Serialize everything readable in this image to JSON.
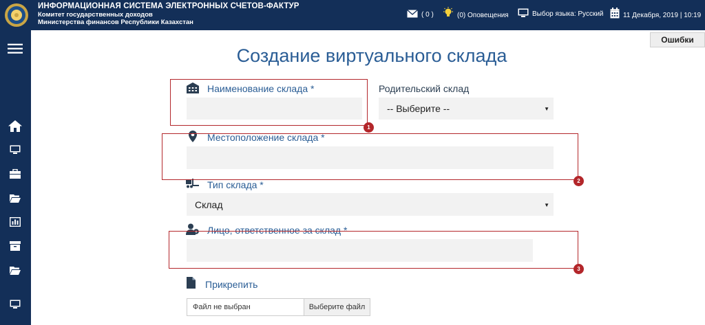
{
  "header": {
    "title": "ИНФОРМАЦИОННАЯ СИСТЕМА ЭЛЕКТРОННЫХ СЧЕТОВ-ФАКТУР",
    "subtitle1": "Комитет государственных доходов",
    "subtitle2": "Министерства финансов Республики Казахстан",
    "messages": "( 0 )",
    "notifications": "(0) Оповещения",
    "language": "Выбор языка: Русский",
    "datetime": "11 Декабря, 2019 | 10:19"
  },
  "errors_button": "Ошибки",
  "page_title": "Создание виртуального склада",
  "form": {
    "warehouse_name_label": "Наименование склада *",
    "parent_warehouse_label": "Родительский склад",
    "parent_warehouse_value": "-- Выберите --",
    "location_label": "Местоположение склада *",
    "type_label": "Тип склада *",
    "type_value": "Склад",
    "responsible_label": "Лицо, ответственное за склад *",
    "attach_label": "Прикрепить",
    "file_name": "Файл не выбран",
    "file_button": "Выберите файл"
  },
  "callouts": [
    "1",
    "2",
    "3"
  ],
  "sidebar": [
    "menu-icon",
    "home-icon",
    "monitor-icon",
    "briefcase-icon",
    "folder-icon",
    "chart-icon",
    "archive-icon",
    "folder-icon",
    "monitor-icon"
  ],
  "colors": {
    "header_bg": "#132f58",
    "accent": "#2a5d95",
    "highlight": "#b3262a",
    "field_bg": "#f2f2f2"
  }
}
